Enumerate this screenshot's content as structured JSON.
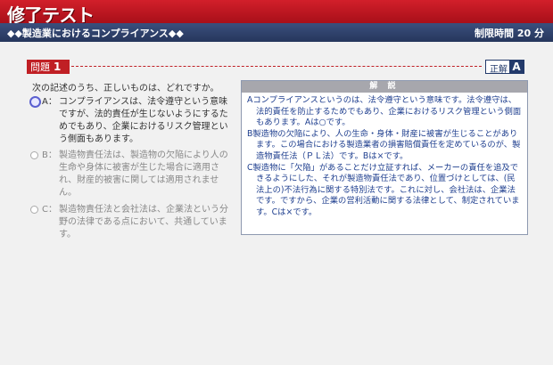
{
  "header": {
    "title": "修了テスト",
    "course": "◆◆製造業におけるコンプライアンス◆◆",
    "time_limit": "制限時間 20 分"
  },
  "question": {
    "label": "問題",
    "number": "1",
    "prompt": "次の記述のうち、正しいものは、どれですか。"
  },
  "answer": {
    "label": "正解",
    "value": "A"
  },
  "options": [
    {
      "letter": "A：",
      "text": "コンプライアンスは、法令遵守という意味ですが、法的責任が生じないようにするためでもあり、企業におけるリスク管理という側面もあります。",
      "selected": true
    },
    {
      "letter": "B：",
      "text": "製造物責任法は、製造物の欠陥により人の生命や身体に被害が生じた場合に適用され、財産的被害に関しては適用されません。",
      "selected": false
    },
    {
      "letter": "C：",
      "text": "製造物責任法と会社法は、企業法という分野の法律である点において、共通しています。",
      "selected": false
    }
  ],
  "explanation": {
    "heading": "解 説",
    "paragraphs": [
      "Aコンプライアンスというのは、法令遵守という意味です。法令遵守は、法的責任を防止するためでもあり、企業におけるリスク管理という側面もあります。Aは○です。",
      "B製造物の欠陥により、人の生命・身体・財産に被害が生じることがあります。この場合における製造業者の損害賠償責任を定めているのが、製造物責任法（ＰＬ法）です。Bは×です。",
      "C製造物に「欠陥」があることだけ立証すれば、メーカーの責任を追及できるようにした、それが製造物責任法であり、位置づけとしては、(民法上の)不法行為に関する特別法です。これに対し、会社法は、企業法です。ですから、企業の営利活動に関する法律として、制定されています。Cは×です。"
    ]
  },
  "colors": {
    "title_red": "#c01f24",
    "nav_blue": "#26365c",
    "explain_text": "#1f3f8f"
  }
}
